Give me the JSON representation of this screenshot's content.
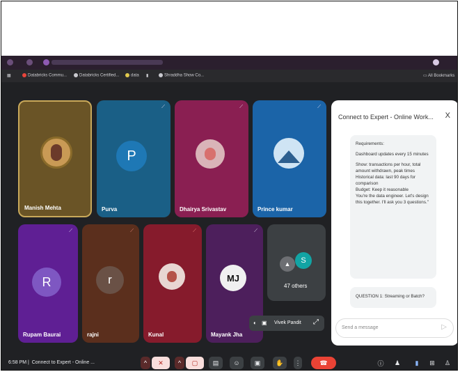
{
  "browser": {
    "bookmarks": [
      {
        "label": "Databricks Commu..."
      },
      {
        "label": "Databricks Certified..."
      },
      {
        "label": "data"
      },
      {
        "label": "Shraddha Show Co..."
      }
    ],
    "all_bookmarks": "All Bookmarks"
  },
  "participants": [
    {
      "name": "Manish Mehta"
    },
    {
      "name": "Purva",
      "initial": "P"
    },
    {
      "name": "Dhairya Srivastav"
    },
    {
      "name": "Prince kumar"
    },
    {
      "name": "Rupam Baurai",
      "initial": "R"
    },
    {
      "name": "rajni",
      "initial": "r"
    },
    {
      "name": "Kunal"
    },
    {
      "name": "Mayank Jha",
      "initial": "MJ"
    }
  ],
  "others": {
    "initial": "S",
    "label": "47 others"
  },
  "self_view": {
    "name": "Vivek Pandit"
  },
  "chat": {
    "title": "Connect to Expert - Online Work...",
    "close": "X",
    "message": {
      "heading": "Requirements:",
      "lines": [
        "Dashboard updates every 15 minutes",
        "Show: transactions per hour, total amount withdrawn, peak times",
        "Historical data: last 90 days for comparison",
        "Budget: Keep it reasonable",
        "You're the data engineer. Let's design this together. I'll ask you 3 questions.\""
      ]
    },
    "question": "QUESTION 1: Streaming or Batch?",
    "input_placeholder": "Send a message"
  },
  "meeting": {
    "time": "6:58 PM",
    "title": "Connect to Expert - Online ..."
  },
  "colors": {
    "call_bg": "#202124",
    "end_call": "#ea4335",
    "mic_off": "#f9dedc",
    "chat_bg": "#ffffff"
  }
}
